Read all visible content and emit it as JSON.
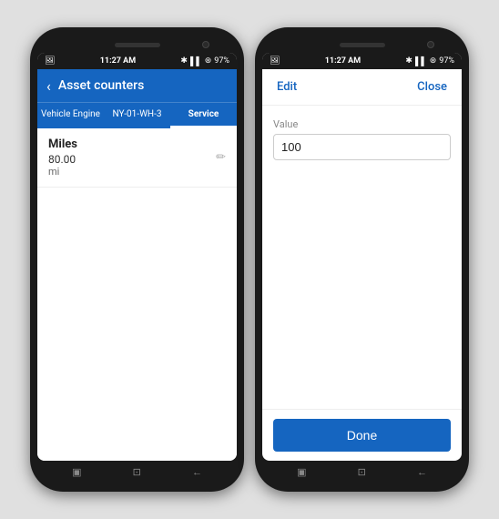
{
  "phone1": {
    "statusBar": {
      "left": "📷",
      "battery": "97%",
      "time": "11:27 AM",
      "signal": "📶"
    },
    "header": {
      "back": "‹",
      "title": "Asset counters"
    },
    "tabs": [
      {
        "label": "Vehicle Engine",
        "active": false
      },
      {
        "label": "NY-01-WH-3",
        "active": false
      },
      {
        "label": "Service",
        "active": true
      }
    ],
    "card": {
      "title": "Miles",
      "value": "80.00",
      "unit": "mi",
      "editIcon": "✏"
    },
    "navIcons": [
      "▣",
      "⊡",
      "←"
    ]
  },
  "phone2": {
    "statusBar": {
      "left": "📷",
      "battery": "97%",
      "time": "11:27 AM",
      "signal": "📶"
    },
    "header": {
      "editLabel": "Edit",
      "closeLabel": "Close"
    },
    "form": {
      "valueLabel": "Value",
      "valueInput": "100"
    },
    "doneButton": "Done",
    "navIcons": [
      "▣",
      "⊡",
      "←"
    ]
  }
}
